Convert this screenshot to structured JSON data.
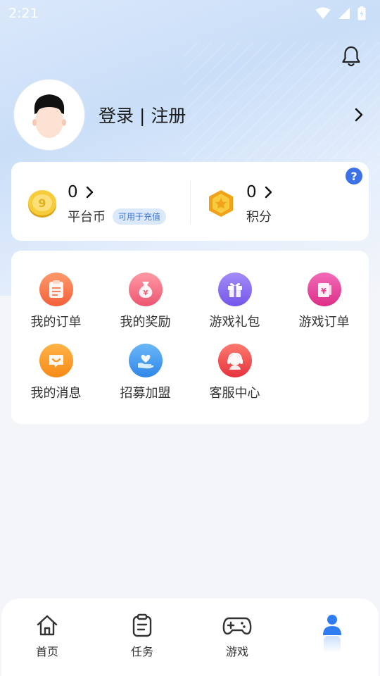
{
  "status_bar": {
    "time": "2:21"
  },
  "profile": {
    "login_label": "登录 | 注册"
  },
  "wallet": {
    "coins": {
      "value": "0",
      "label": "平台币",
      "tag": "可用于充值"
    },
    "points": {
      "value": "0",
      "label": "积分"
    },
    "help_label": "?"
  },
  "menu": {
    "items": [
      {
        "label": "我的订单",
        "icon": "order-icon",
        "color": "#f57448"
      },
      {
        "label": "我的奖励",
        "icon": "money-bag-icon",
        "color": "#f26a7e"
      },
      {
        "label": "游戏礼包",
        "icon": "gift-icon",
        "color": "#8a6cf0"
      },
      {
        "label": "游戏订单",
        "icon": "game-order-icon",
        "color": "#e83c95"
      },
      {
        "label": "我的消息",
        "icon": "message-icon",
        "color": "#f89422"
      },
      {
        "label": "招募加盟",
        "icon": "recruit-icon",
        "color": "#3e9bf0"
      },
      {
        "label": "客服中心",
        "icon": "customer-service-icon",
        "color": "#ee3f46"
      }
    ]
  },
  "tabbar": {
    "tabs": [
      {
        "label": "首页",
        "icon": "home-icon"
      },
      {
        "label": "任务",
        "icon": "task-icon"
      },
      {
        "label": "游戏",
        "icon": "gamepad-icon"
      },
      {
        "label": "",
        "icon": "user-icon",
        "active": true
      }
    ],
    "active_color": "#2f7cf3"
  }
}
